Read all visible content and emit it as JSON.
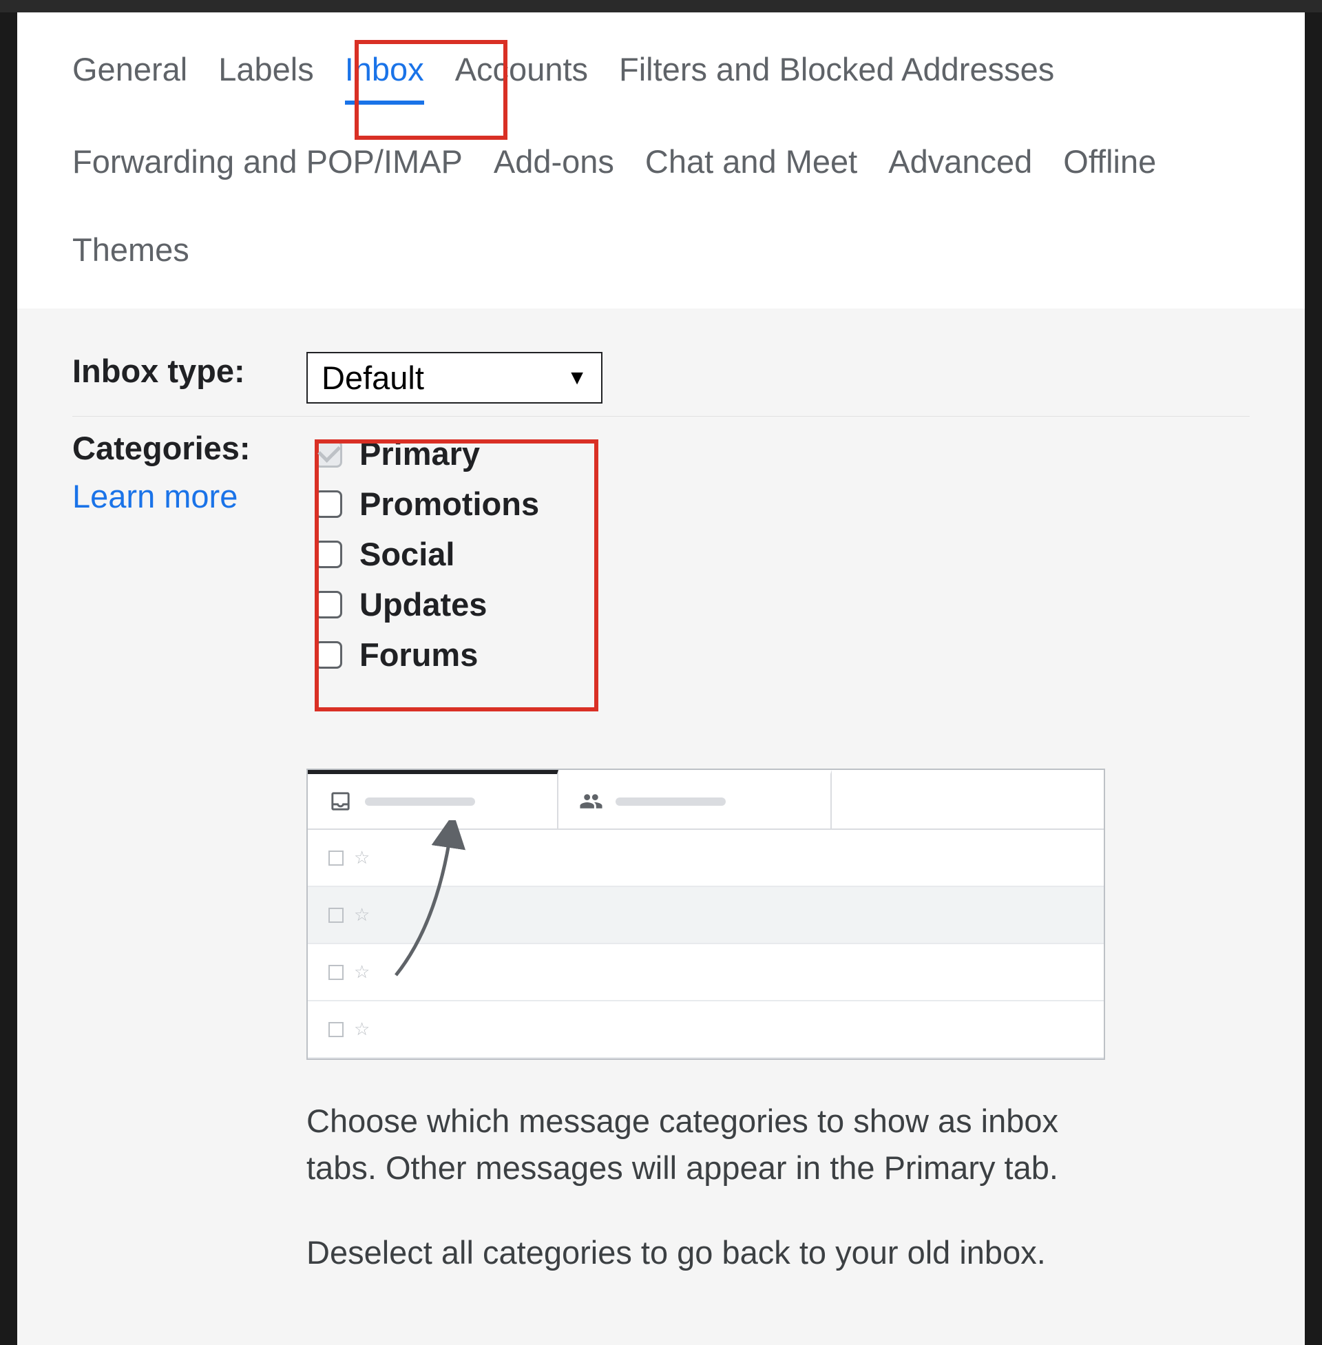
{
  "tabs": {
    "general": "General",
    "labels": "Labels",
    "inbox": "Inbox",
    "accounts": "Accounts",
    "filters": "Filters and Blocked Addresses",
    "forwarding": "Forwarding and POP/IMAP",
    "addons": "Add-ons",
    "chat": "Chat and Meet",
    "advanced": "Advanced",
    "offline": "Offline",
    "themes": "Themes"
  },
  "inbox_type": {
    "label": "Inbox type:",
    "selected": "Default"
  },
  "categories": {
    "label": "Categories:",
    "learn_more": "Learn more",
    "items": [
      {
        "label": "Primary",
        "checked": true,
        "disabled": true
      },
      {
        "label": "Promotions",
        "checked": false,
        "disabled": false
      },
      {
        "label": "Social",
        "checked": false,
        "disabled": false
      },
      {
        "label": "Updates",
        "checked": false,
        "disabled": false
      },
      {
        "label": "Forums",
        "checked": false,
        "disabled": false
      }
    ]
  },
  "description": {
    "p1": "Choose which message categories to show as inbox tabs. Other messages will appear in the Primary tab.",
    "p2": "Deselect all categories to go back to your old inbox."
  }
}
